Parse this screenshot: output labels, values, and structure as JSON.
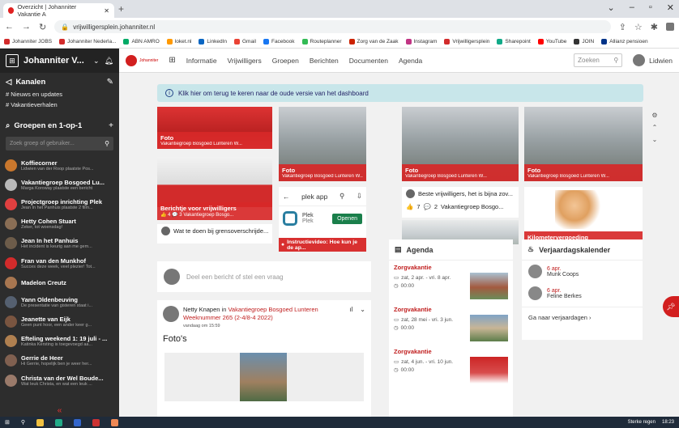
{
  "browser": {
    "tab_title": "Overzicht | Johanniter Vakantie A",
    "url": "vrijwilligersplein.johanniter.nl",
    "bookmarks": [
      "Johanniter JOBS",
      "Johanniter Nederla...",
      "ABN AMRO",
      "loket.nl",
      "LinkedIn",
      "Gmail",
      "Facebook",
      "Routeplanner",
      "Zorg van de Zaak",
      "Instagram",
      "Vrijwilligersplein",
      "Sharepoint",
      "YouTube",
      "JOIN",
      "Allianz pensioen"
    ]
  },
  "sidebar": {
    "title": "Johanniter V...",
    "channels_label": "Kanalen",
    "channels": [
      "# Nieuws en updates",
      "# Vakantieverhalen"
    ],
    "groups_label": "Groepen en 1-op-1",
    "search_placeholder": "Zoek groep of gebruiker...",
    "groups": [
      {
        "name": "Koffiecorner",
        "sub": "Lidwien van der Roop plaatste Pos...",
        "color": "#c9772d"
      },
      {
        "name": "Vakantiegroep Bosgoed Lu...",
        "sub": "Marga Koroway plaatste een bericht",
        "color": "#b9b9b9"
      },
      {
        "name": "Projectgroep inrichting Plek",
        "sub": "Jean In het Panhuis plaatste 2 film...",
        "color": "#e04040"
      },
      {
        "name": "Hetty Cohen Stuart",
        "sub": "Zeker, tot woensdag!",
        "color": "#8a6e55"
      },
      {
        "name": "Jean In het Panhuis",
        "sub": "Het incident is keurig aan me gem...",
        "color": "#6d5c4a"
      },
      {
        "name": "Fran van den Munkhof",
        "sub": "Succes deze week, veel plezier! Tot...",
        "color": "#d22b2b"
      },
      {
        "name": "Madelon Creutz",
        "sub": "",
        "color": "#a87650"
      },
      {
        "name": "Yann Oldenbeuving",
        "sub": "De presentatie van gisteren staat i...",
        "color": "#556070"
      },
      {
        "name": "Jeanette van Eijk",
        "sub": "Geen punt hoor, een ander keer g...",
        "color": "#7a5540"
      },
      {
        "name": "Efteling weekend 1: 19 juli - ...",
        "sub": "Katinka Kersting is toegevoegd aa...",
        "color": "#b08050"
      },
      {
        "name": "Gerrie de Heer",
        "sub": "Hi Gerrie, hopelijk ben je weer her...",
        "color": "#806050"
      },
      {
        "name": "Christa van der Wel Boude...",
        "sub": "Wat leuk Christa, en wat een leuk ...",
        "color": "#9a7a6a"
      }
    ]
  },
  "topnav": {
    "brand": "Johanniter",
    "items": [
      "Informatie",
      "Vrijwilligers",
      "Groepen",
      "Berichten",
      "Documenten",
      "Agenda"
    ],
    "search_placeholder": "Zoeken",
    "user": "Lidwien"
  },
  "banner": "Klik hier om terug te keren naar de oude versie van het dashboard",
  "tiles": [
    {
      "title": "Foto",
      "group": "Vakantiegroep Bosgoed Lunteren W..."
    },
    {
      "title": "Foto",
      "group": "Vakantiegroep Bosgoed Lunteren W..."
    },
    {
      "title": "Foto",
      "group": "Vakantiegroep Bosgoed Lunteren W..."
    },
    {
      "title": "Foto",
      "group": "Vakantiegroep Bosgoed Lunteren W..."
    }
  ],
  "tile_berichtje": {
    "title": "Berichtje voor vrijwilligers",
    "likes": "4",
    "comments": "3",
    "group": "Vakantiegroep Bosgo..."
  },
  "tile_plek": {
    "bar": "plek app",
    "app": "Plek",
    "app_sub": "Plek",
    "open": "Openen",
    "caption": "Instructievideo: Hoe kun je de ap..."
  },
  "tile_beste": {
    "title": "Beste vrijwilligers, het is bijna zov...",
    "likes": "7",
    "comments": "2",
    "group": "Vakantiegroep Bosgo..."
  },
  "tile_wat": "Wat te doen bij grensoverschrijde...",
  "tile_km": "Kilometervergoeding",
  "post_input": "Deel een bericht of stel een vraag",
  "post": {
    "author": "Netty Knapen",
    "in": "in",
    "group": "Vakantiegroep Bosgoed Lunteren Weeknummer 265 (2-4/8-4 2022)",
    "date": "vandaag om 15:59",
    "title": "Foto's"
  },
  "agenda": {
    "title": "Agenda",
    "items": [
      {
        "title": "Zorgvakantie",
        "dates": "zat, 2 apr. - vri. 8 apr.",
        "time": "00:00"
      },
      {
        "title": "Zorgvakantie",
        "dates": "zat, 28 mei - vri. 3 jun.",
        "time": "00:00"
      },
      {
        "title": "Zorgvakantie",
        "dates": "zat, 4 jun. - vri. 10 jun.",
        "time": "00:00"
      }
    ]
  },
  "birthdays": {
    "title": "Verjaardagskalender",
    "items": [
      {
        "date": "6 apr.",
        "name": "Munk Coops"
      },
      {
        "date": "6 apr.",
        "name": "Feline Berkes"
      }
    ],
    "link": "Ga naar verjaardagen"
  },
  "taskbar": {
    "weather": "Sterke regen",
    "time": "18:23"
  }
}
